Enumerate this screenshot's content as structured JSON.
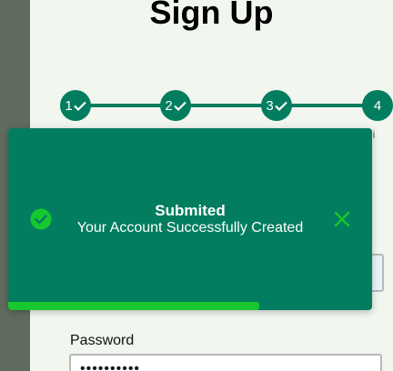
{
  "signup": {
    "title": "Sign Up",
    "steps": [
      {
        "number": "1",
        "completed": true
      },
      {
        "number": "2",
        "completed": true
      },
      {
        "number": "3",
        "completed": true
      },
      {
        "number": "4",
        "completed": false
      }
    ],
    "step4_label_partial": "bmi",
    "password_label": "Password",
    "password_value": "••••••••••"
  },
  "toast": {
    "title": "Submited",
    "message": "Your Account Successfully Created",
    "progress": 0.69,
    "colors": {
      "background": "#027d5f",
      "accent": "#17c72f",
      "icon": "#17c72f"
    }
  },
  "icons": {
    "success": "check-circle-icon",
    "close": "close-icon",
    "step_done": "checkmark-icon"
  }
}
